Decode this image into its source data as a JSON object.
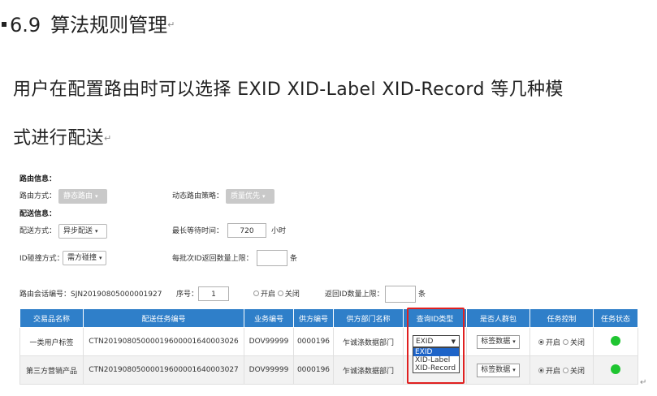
{
  "doc": {
    "section_number": "6.9",
    "section_title": "算法规则管理",
    "para_line1": "用户在配置路由时可以选择 EXID XID-Label XID-Record 等几种模",
    "para_line2": "式进行配送",
    "para_mark": "↵"
  },
  "form": {
    "route_info_heading": "路由信息：",
    "route_mode_label": "路由方式：",
    "route_mode_value": "静态路由",
    "dynamic_strategy_label": "动态路由策略：",
    "dynamic_strategy_value": "质量优先",
    "delivery_info_heading": "配送信息：",
    "delivery_mode_label": "配送方式：",
    "delivery_mode_value": "异步配送",
    "max_wait_label": "最长等待时间：",
    "max_wait_value": "720",
    "max_wait_unit": "小时",
    "id_collision_label": "ID碰撞方式：",
    "id_collision_value": "需方碰撞",
    "batch_limit_label": "每批次ID返回数量上限：",
    "batch_limit_value": "",
    "batch_limit_unit": "条",
    "session_label": "路由会话编号：SJN20190805000001927",
    "seq_label": "序号：",
    "seq_value": "1",
    "open_label": "开启",
    "close_label": "关闭",
    "return_limit_label": "返回ID数量上限：",
    "return_limit_value": "",
    "return_limit_unit": "条"
  },
  "table": {
    "headers": [
      "交易品名称",
      "配送任务编号",
      "业务编号",
      "供方编号",
      "供方部门名称",
      "查询ID类型",
      "是否人群包",
      "任务控制",
      "任务状态"
    ],
    "rows": [
      {
        "name": "一类用户标签",
        "task_no": "CTN20190805000019600001640003026",
        "biz_no": "DOV99999",
        "supplier_no": "0000196",
        "dept": "乍诚涤数据部门",
        "id_type": "EXID",
        "crowd": "标签数据",
        "ctrl_on": "开启",
        "ctrl_off": "关闭"
      },
      {
        "name": "第三方营销产品",
        "task_no": "CTN20190805000019600001640003027",
        "biz_no": "DOV99999",
        "supplier_no": "0000196",
        "dept": "乍诚涤数据部门",
        "id_type": "",
        "crowd": "标签数据",
        "ctrl_on": "开启",
        "ctrl_off": "关闭"
      }
    ],
    "id_type_options": [
      "EXID",
      "XID-Label",
      "XID-Record"
    ],
    "status_color": "#1fc531",
    "header_color": "#2f7fc9",
    "highlight_color": "#e02020"
  }
}
